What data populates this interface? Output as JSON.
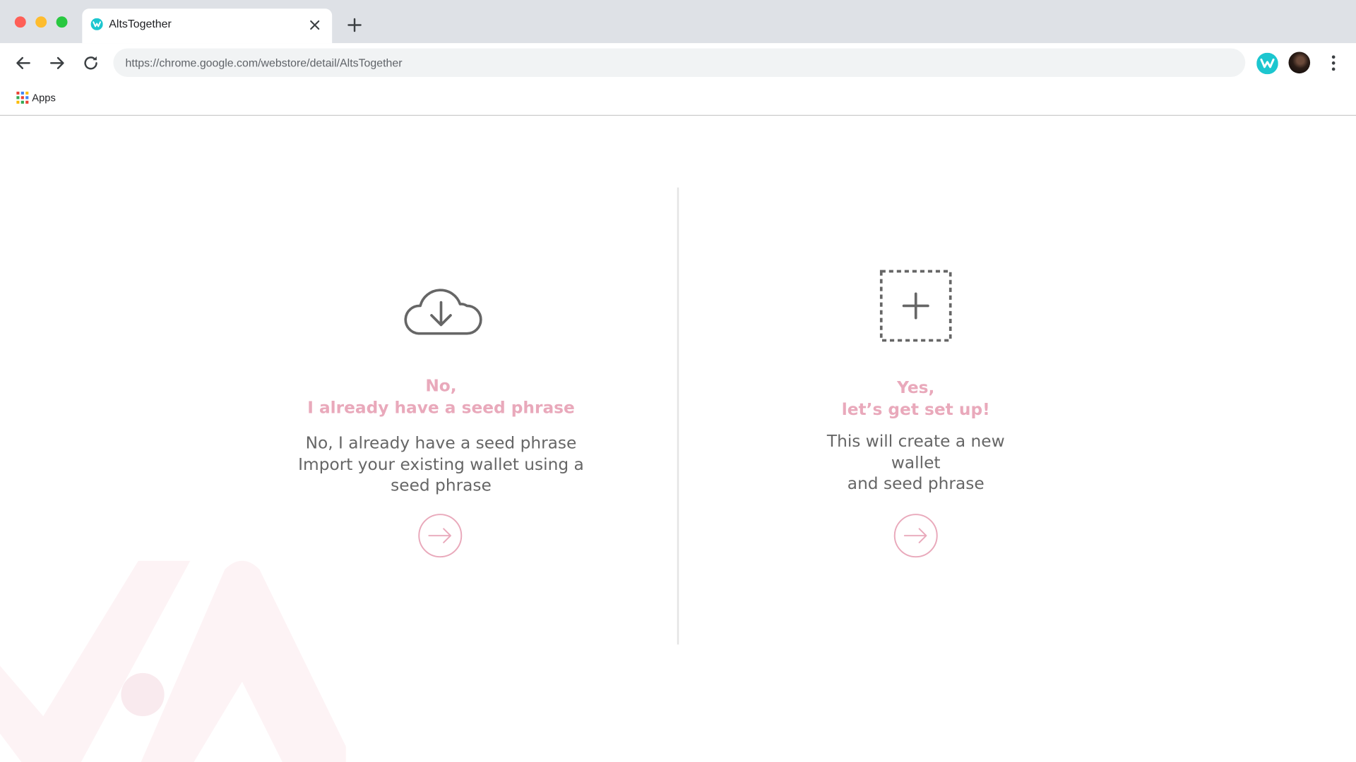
{
  "browser": {
    "tab_title": "AltsTogether",
    "address": "https://chrome.google.com/webstore/detail/AltsTogether",
    "bookmarks": [
      {
        "label": "Apps",
        "icon": "apps-grid-icon"
      }
    ]
  },
  "colors": {
    "accent_pink": "#e9a9bb",
    "text_gray": "#666666",
    "brand_teal": "#1cc6cf"
  },
  "options": {
    "import": {
      "heading_line1": "No,",
      "heading_line2": "I already have a seed phrase",
      "desc_line1": "No, I already have a seed phrase",
      "desc_line2": "Import your existing wallet using a seed phrase",
      "icon": "cloud-download-icon",
      "action_icon": "arrow-right-circle-icon"
    },
    "create": {
      "heading_line1": "Yes,",
      "heading_line2": "let’s get set up!",
      "desc_line1": "This will create a new wallet",
      "desc_line2": "and seed phrase",
      "icon": "dashed-plus-box-icon",
      "action_icon": "arrow-right-circle-icon"
    }
  }
}
